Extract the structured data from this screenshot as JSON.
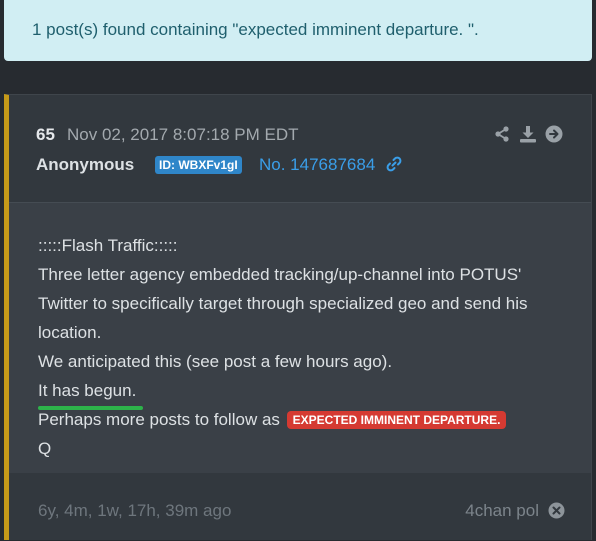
{
  "search_result": "1 post(s) found containing \"expected imminent departure. \".",
  "post": {
    "number": "65",
    "date": "Nov 02, 2017 8:07:18 PM EDT",
    "author": "Anonymous",
    "id_badge": "ID: WBXFv1gI",
    "post_no": "No. 147687684",
    "lines": [
      ":::::Flash Traffic:::::",
      "Three letter agency embedded tracking/up-channel into POTUS'",
      "Twitter to specifically target through specialized geo and send his",
      "location.",
      "We anticipated this (see post a few hours ago).",
      "It has begun."
    ],
    "follow_prefix": "Perhaps more posts to follow as",
    "highlight": "EXPECTED IMMINENT DEPARTURE.",
    "signature": "Q",
    "ago": "6y, 4m, 1w, 17h, 39m ago",
    "source": "4chan pol"
  },
  "icons": [
    "share-icon",
    "download-icon",
    "arrow-right-icon",
    "link-icon",
    "close-icon"
  ],
  "colors": {
    "accent_gold": "#c69a19",
    "link_blue": "#3a9ee8",
    "highlight_red": "#d53a32",
    "underline_green": "#2db34a"
  }
}
